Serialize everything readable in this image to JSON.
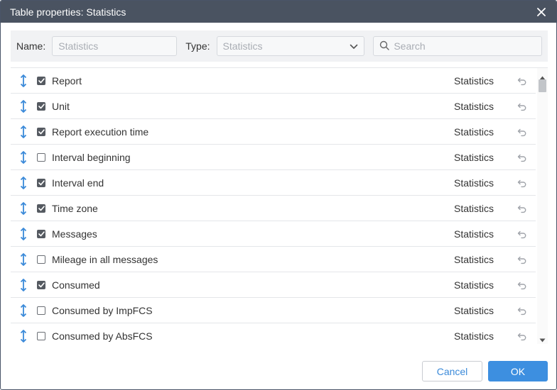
{
  "window": {
    "title": "Table properties: Statistics"
  },
  "filters": {
    "name_label": "Name:",
    "name_value": "Statistics",
    "type_label": "Type:",
    "type_value": "Statistics",
    "search_placeholder": "Search"
  },
  "rows": [
    {
      "label": "Report",
      "type": "Statistics",
      "checked": true
    },
    {
      "label": "Unit",
      "type": "Statistics",
      "checked": true
    },
    {
      "label": "Report execution time",
      "type": "Statistics",
      "checked": true
    },
    {
      "label": "Interval beginning",
      "type": "Statistics",
      "checked": false
    },
    {
      "label": "Interval end",
      "type": "Statistics",
      "checked": true
    },
    {
      "label": "Time zone",
      "type": "Statistics",
      "checked": true
    },
    {
      "label": "Messages",
      "type": "Statistics",
      "checked": true
    },
    {
      "label": "Mileage in all messages",
      "type": "Statistics",
      "checked": false
    },
    {
      "label": "Consumed",
      "type": "Statistics",
      "checked": true
    },
    {
      "label": "Consumed by ImpFCS",
      "type": "Statistics",
      "checked": false
    },
    {
      "label": "Consumed by AbsFCS",
      "type": "Statistics",
      "checked": false
    }
  ],
  "footer": {
    "cancel_label": "Cancel",
    "ok_label": "OK"
  },
  "colors": {
    "titlebar": "#4a5361",
    "accent": "#3d8fe0",
    "drag_icon": "#3b8ad9"
  },
  "icons": {
    "close": "close-icon",
    "dropdown": "chevron-down-icon",
    "search": "search-icon",
    "drag": "drag-handle-icon",
    "reset": "reset-icon"
  }
}
